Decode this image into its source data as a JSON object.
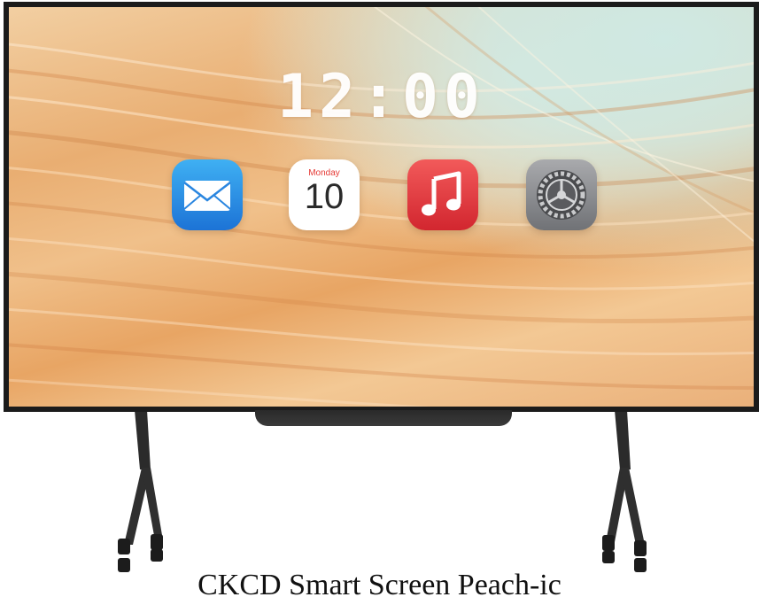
{
  "screen": {
    "clock": "12:00"
  },
  "apps": [
    {
      "name": "Mail",
      "icon": "mail-icon"
    },
    {
      "name": "Calendar",
      "icon": "calendar-icon",
      "day": "Monday",
      "date": "10"
    },
    {
      "name": "Music",
      "icon": "music-icon"
    },
    {
      "name": "Settings",
      "icon": "settings-gear-icon"
    }
  ],
  "caption": "CKCD Smart Screen Peach-ic",
  "colors": {
    "frame": "#1b1b1b",
    "mail": "#1c73d6",
    "music": "#d2262f",
    "settings": "#707276",
    "calendar_accent": "#e53935"
  }
}
